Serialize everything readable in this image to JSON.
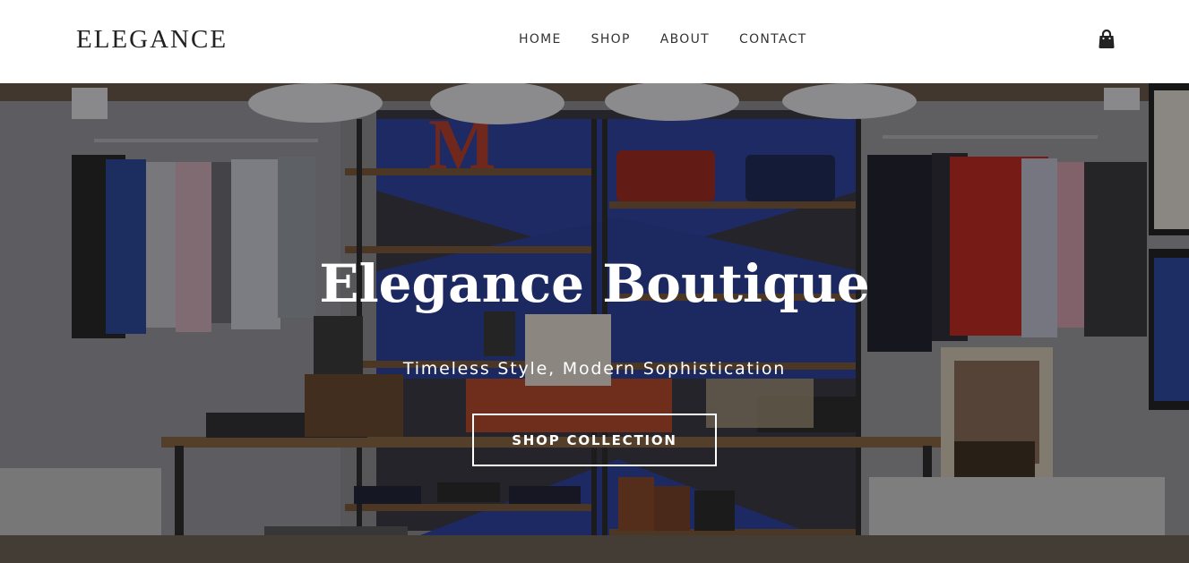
{
  "header": {
    "logo": "ELEGANCE",
    "nav": [
      {
        "label": "HOME"
      },
      {
        "label": "SHOP"
      },
      {
        "label": "ABOUT"
      },
      {
        "label": "CONTACT"
      }
    ],
    "cart_icon": "shopping-bag-icon"
  },
  "hero": {
    "title": "Elegance Boutique",
    "subtitle": "Timeless Style, Modern Sophistication",
    "button_label": "SHOP COLLECTION",
    "background_description_icon": "boutique-interior-photo"
  },
  "colors": {
    "header_bg": "#ffffff",
    "logo_text": "#222222",
    "nav_text": "#333333",
    "hero_text": "#ffffff",
    "overlay": "rgba(10,8,8,0.42)"
  }
}
